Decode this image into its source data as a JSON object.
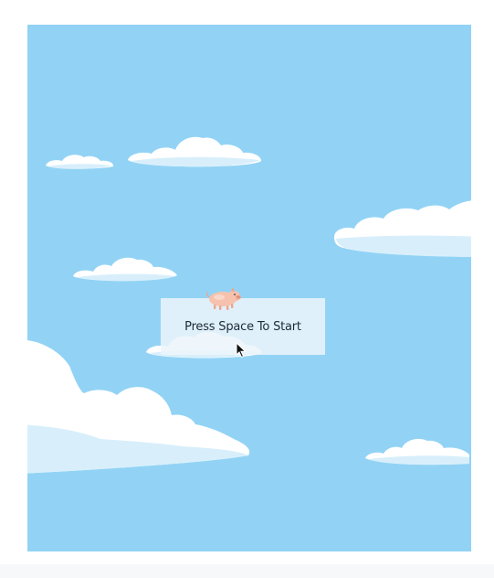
{
  "game": {
    "start_prompt": "Press Space To Start",
    "player_sprite": "pig-icon",
    "pointer": "mouse-cursor-icon",
    "sky_color": "#92d3f5",
    "cloud_colors": [
      "#ffffff",
      "#d8effb"
    ]
  }
}
